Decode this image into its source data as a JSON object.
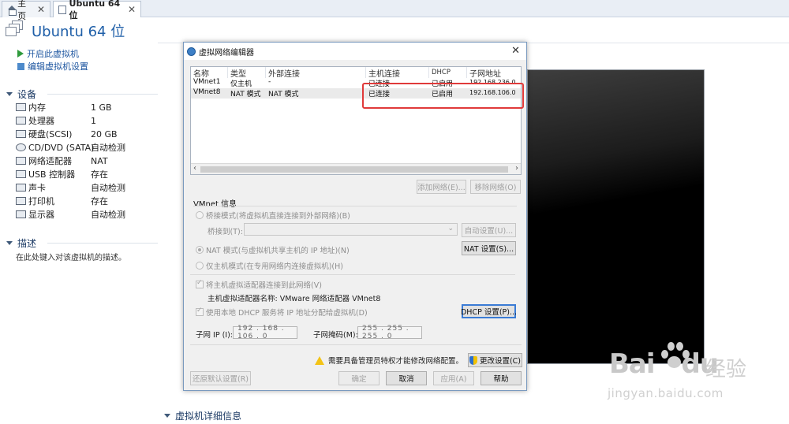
{
  "tabs": [
    {
      "label": "主页"
    },
    {
      "label": "Ubuntu 64 位"
    }
  ],
  "header": {
    "title": "Ubuntu 64 位"
  },
  "actions": {
    "power_on": "开启此虚拟机",
    "edit_settings": "编辑虚拟机设置"
  },
  "devices": {
    "heading": "设备",
    "items": [
      {
        "name": "内存",
        "value": "1 GB",
        "icon": "memory-icon"
      },
      {
        "name": "处理器",
        "value": "1",
        "icon": "cpu-icon"
      },
      {
        "name": "硬盘(SCSI)",
        "value": "20 GB",
        "icon": "disk-icon"
      },
      {
        "name": "CD/DVD (SATA)",
        "value": "自动检测",
        "icon": "cd-icon"
      },
      {
        "name": "网络适配器",
        "value": "NAT",
        "icon": "network-icon"
      },
      {
        "name": "USB 控制器",
        "value": "存在",
        "icon": "usb-icon"
      },
      {
        "name": "声卡",
        "value": "自动检测",
        "icon": "sound-icon"
      },
      {
        "name": "打印机",
        "value": "存在",
        "icon": "printer-icon"
      },
      {
        "name": "显示器",
        "value": "自动检测",
        "icon": "display-icon"
      }
    ]
  },
  "description": {
    "heading": "描述",
    "placeholder": "在此处键入对该虚拟机的描述。"
  },
  "details": {
    "heading": "虚拟机详细信息"
  },
  "dialog": {
    "title": "虚拟网络编辑器",
    "columns": [
      "名称",
      "类型",
      "外部连接",
      "主机连接",
      "DHCP",
      "子网地址"
    ],
    "rows": [
      [
        "VMnet1",
        "仅主机",
        "-",
        "已连接",
        "已启用",
        "192.168.236.0"
      ],
      [
        "VMnet8",
        "NAT 模式",
        "NAT 模式",
        "已连接",
        "已启用",
        "192.168.106.0"
      ]
    ],
    "add_network": "添加网络(E)...",
    "remove_network": "移除网络(O)",
    "vmnet_info": "VMnet 信息",
    "bridge_mode": "桥接模式(将虚拟机直接连接到外部网络)(B)",
    "bridge_to": "桥接到(T):",
    "auto_settings": "自动设置(U)...",
    "nat_mode": "NAT 模式(与虚拟机共享主机的 IP 地址)(N)",
    "nat_settings": "NAT 设置(S)...",
    "host_only": "仅主机模式(在专用网络内连接虚拟机)(H)",
    "connect_host": "将主机虚拟适配器连接到此网络(V)",
    "adapter_name": "主机虚拟适配器名称: VMware 网络适配器 VMnet8",
    "use_dhcp": "使用本地 DHCP 服务将 IP 地址分配给虚拟机(D)",
    "dhcp_settings": "DHCP 设置(P)...",
    "subnet_ip_label": "子网 IP (I):",
    "subnet_ip": "192 . 168 . 106 . 0",
    "subnet_mask_label": "子网掩码(M):",
    "subnet_mask": "255 . 255 . 255 . 0",
    "admin_warning": "需要具备管理员特权才能修改网络配置。",
    "change_settings": "更改设置(C)",
    "restore_defaults": "还原默认设置(R)",
    "ok": "确定",
    "cancel": "取消",
    "apply": "应用(A)",
    "help": "帮助"
  },
  "watermark": {
    "brand": "Bai",
    "brand2": "du",
    "cn": "经验",
    "url": "jingyan.baidu.com"
  },
  "colors": {
    "accent": "#1f5fa8",
    "highlight": "#e03a3a",
    "power": "#2f9a3c"
  }
}
